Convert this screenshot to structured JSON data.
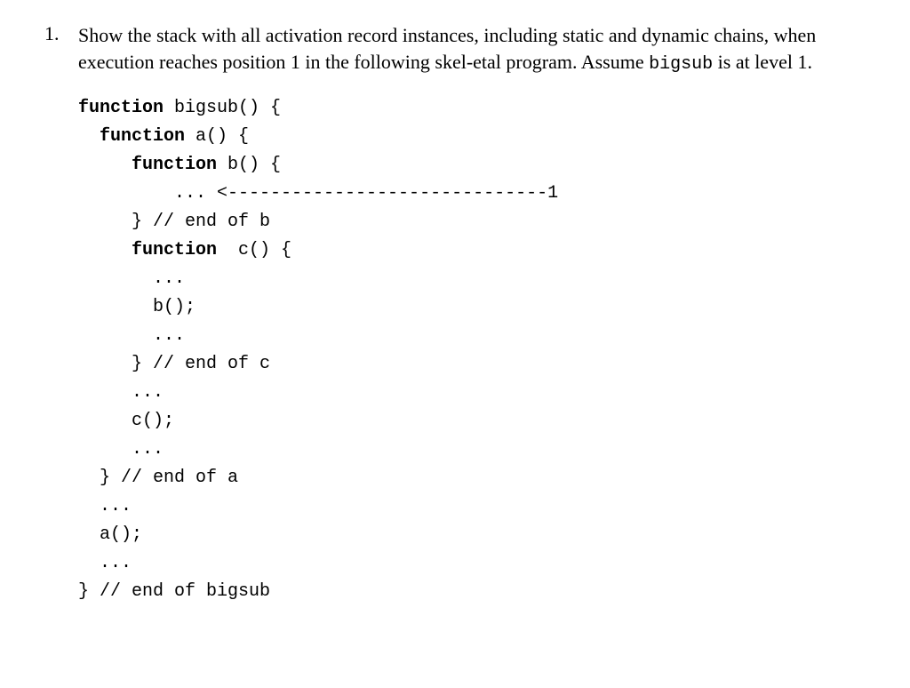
{
  "problem": {
    "number": "1.",
    "text_before_mono": "Show the stack with all activation record instances, including static and dynamic chains, when execution reaches position 1 in the following skel-etal program. Assume ",
    "mono_word": "bigsub",
    "text_after_mono": " is at level 1."
  },
  "code": {
    "l1_kw": "function",
    "l1_rest": " bigsub() {",
    "l2_kw": "function",
    "l2_rest": " a() {",
    "l3_kw": "function",
    "l3_rest": " b() {",
    "l4": "         ... <------------------------------1",
    "l5": "     } // end of b",
    "l6_kw": "function",
    "l6_rest": "  c() {",
    "l7": "       ...",
    "l8": "       b();",
    "l9": "       ...",
    "l10": "     } // end of c",
    "l11": "     ...",
    "l12": "     c();",
    "l13": "     ...",
    "l14": "  } // end of a",
    "l15": "  ...",
    "l16": "  a();",
    "l17": "  ...",
    "l18": "} // end of bigsub"
  }
}
